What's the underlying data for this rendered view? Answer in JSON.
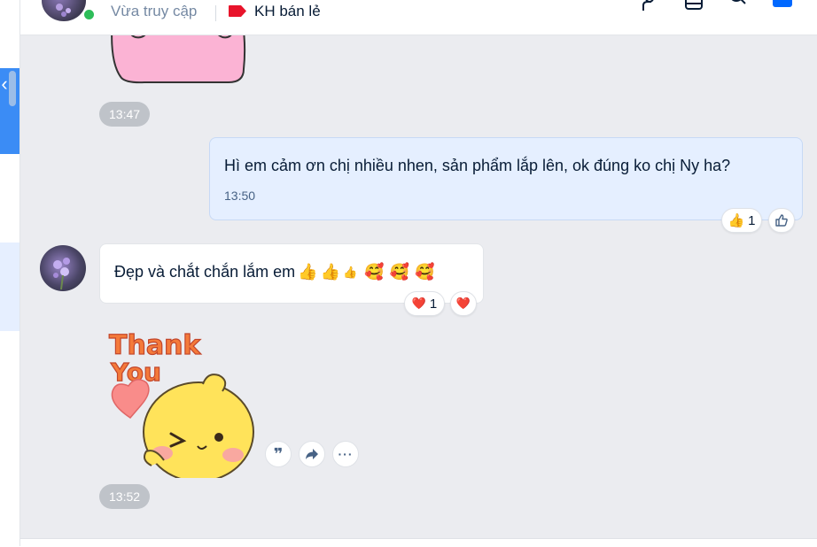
{
  "header": {
    "last_visit": "Vừa truy cập",
    "tag_label": "KH bán lẻ",
    "tag_color": "#e8142b",
    "icons": [
      "contact-icon",
      "layout-icon",
      "search-icon",
      "info-panel-icon"
    ]
  },
  "messages": [
    {
      "type": "sticker",
      "direction": "in",
      "time": "13:47"
    },
    {
      "type": "text",
      "direction": "out",
      "text": "Hì em cảm ơn chị nhiều nhen, sản phẩm lắp lên, ok đúng ko chị Ny ha?",
      "time": "13:50",
      "reactions": [
        {
          "emoji": "👍",
          "count": "1"
        }
      ],
      "react_button": "like-icon"
    },
    {
      "type": "text",
      "direction": "in",
      "text": "Đẹp và chắt chắn lắm em",
      "emojis": [
        "👍",
        "👍",
        "👍",
        "🥰",
        "🥰",
        "🥰"
      ],
      "reactions": [
        {
          "emoji": "❤️",
          "count": "1"
        }
      ],
      "react_button": "❤️"
    },
    {
      "type": "sticker",
      "direction": "in",
      "sticker_text": "Thank You",
      "time": "13:52",
      "actions": [
        "quote-icon",
        "forward-icon",
        "more-icon"
      ]
    }
  ],
  "colors": {
    "accent": "#3b8cf5",
    "bubble_out": "#e5efff",
    "chat_bg": "#ebecf0",
    "online": "#2ebd59"
  }
}
